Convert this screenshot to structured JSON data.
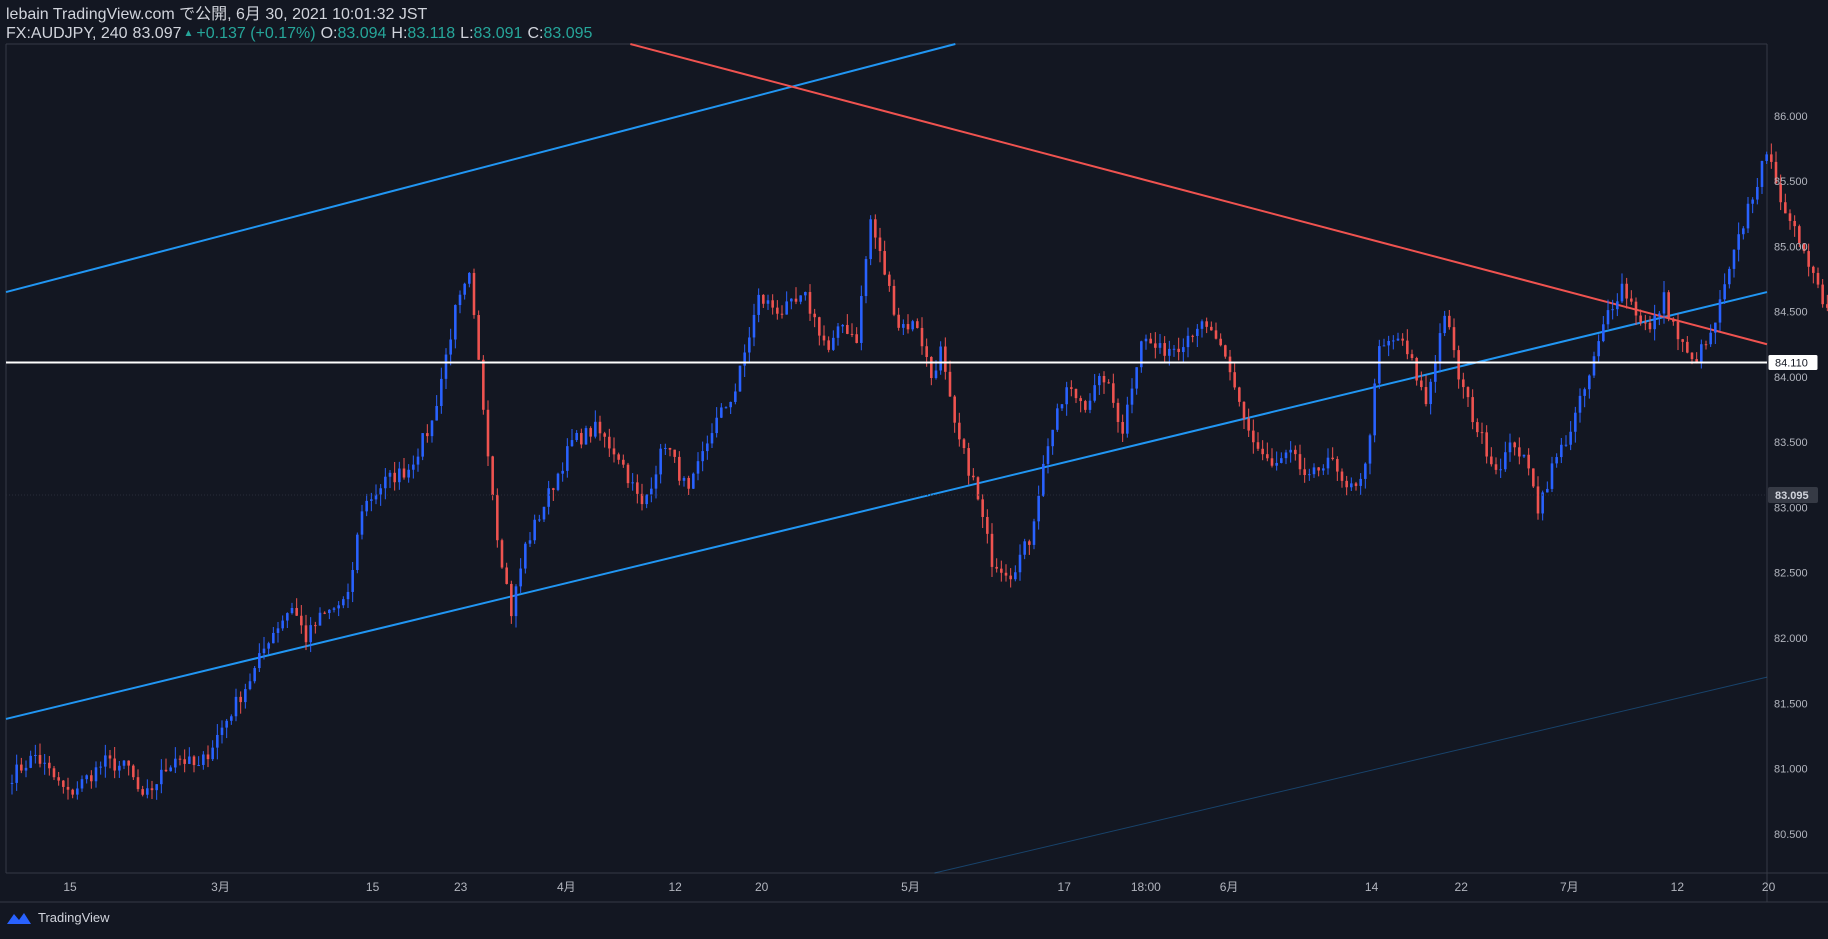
{
  "header": {
    "publish_line": "lebain TradingView.com で公開, 6月 30, 2021 10:01:32 JST",
    "symbol": "FX:AUDJPY, 240",
    "last": "83.097",
    "change": "+0.137 (+0.17%)",
    "o_label": "O:",
    "o_value": "83.094",
    "h_label": "H:",
    "h_value": "83.118",
    "l_label": "L:",
    "l_value": "83.091",
    "c_label": "C:",
    "c_value": "83.095"
  },
  "footer": {
    "brand": "TradingView",
    "icon": "tradingview-logo-icon"
  },
  "colors": {
    "background": "#131722",
    "up": "#2962ff",
    "down": "#ef5350",
    "channel": "#2196f3",
    "resistance": "#f05350",
    "level": "#ffffff",
    "text": "#d1d4dc",
    "ohlc_value": "#26a69a"
  },
  "chart_data": {
    "type": "candlestick",
    "title": "FX:AUDJPY, 240",
    "ylim": [
      80.2,
      86.55
    ],
    "y_ticks": [
      "86.000",
      "85.500",
      "85.000",
      "84.500",
      "84.000",
      "83.500",
      "83.000",
      "82.500",
      "82.000",
      "81.500",
      "81.000",
      "80.500"
    ],
    "x_ticks": [
      "15",
      "3月",
      "15",
      "23",
      "4月",
      "12",
      "20",
      "5月",
      "17",
      "18:00",
      "6月",
      "14",
      "22",
      "7月",
      "12",
      "20"
    ],
    "x_tick_idx": [
      80,
      268,
      458,
      568,
      700,
      836,
      944,
      1130,
      1322,
      1424,
      1528,
      1706,
      1818,
      1953,
      2088,
      2202
    ],
    "price_labels": [
      {
        "label": "84.110",
        "value": 84.11,
        "kind": "level"
      },
      {
        "label": "83.095",
        "value": 83.095,
        "kind": "last"
      }
    ],
    "lines": [
      {
        "name": "channel-upper",
        "color": "channel",
        "from": {
          "idx": 0,
          "price": 84.65
        },
        "to": {
          "idx": 1186,
          "price": 86.55
        }
      },
      {
        "name": "channel-lower",
        "color": "channel",
        "from": {
          "idx": 0,
          "price": 81.38
        },
        "to": {
          "idx": 2200,
          "price": 84.65
        }
      },
      {
        "name": "channel-parallel-faint",
        "color": "channel",
        "faint": true,
        "from": {
          "idx": 1160,
          "price": 80.2
        },
        "to": {
          "idx": 2200,
          "price": 81.7
        }
      },
      {
        "name": "resistance",
        "color": "resistance",
        "from": {
          "idx": 780,
          "price": 86.55
        },
        "to": {
          "idx": 2200,
          "price": 84.25
        }
      }
    ],
    "level_line": {
      "value": 84.11
    },
    "candle_count": 330,
    "idx_per_candle": 5.83,
    "keypoints": [
      [
        0,
        80.95
      ],
      [
        5,
        81.1
      ],
      [
        12,
        80.8
      ],
      [
        20,
        81.05
      ],
      [
        25,
        81.0
      ],
      [
        28,
        80.75
      ],
      [
        35,
        81.1
      ],
      [
        40,
        81.0
      ],
      [
        48,
        81.5
      ],
      [
        52,
        81.75
      ],
      [
        55,
        82.0
      ],
      [
        60,
        82.25
      ],
      [
        63,
        82.0
      ],
      [
        66,
        82.15
      ],
      [
        72,
        82.3
      ],
      [
        75,
        83.0
      ],
      [
        80,
        83.2
      ],
      [
        85,
        83.3
      ],
      [
        90,
        83.65
      ],
      [
        95,
        84.5
      ],
      [
        98,
        84.75
      ],
      [
        100,
        84.1
      ],
      [
        104,
        82.8
      ],
      [
        107,
        82.2
      ],
      [
        110,
        82.7
      ],
      [
        115,
        83.1
      ],
      [
        120,
        83.5
      ],
      [
        125,
        83.6
      ],
      [
        130,
        83.4
      ],
      [
        135,
        83.0
      ],
      [
        140,
        83.5
      ],
      [
        145,
        83.1
      ],
      [
        150,
        83.6
      ],
      [
        155,
        83.9
      ],
      [
        160,
        84.6
      ],
      [
        165,
        84.5
      ],
      [
        170,
        84.6
      ],
      [
        175,
        84.2
      ],
      [
        178,
        84.4
      ],
      [
        181,
        84.3
      ],
      [
        184,
        85.2
      ],
      [
        187,
        84.8
      ],
      [
        190,
        84.4
      ],
      [
        194,
        84.4
      ],
      [
        197,
        84.0
      ],
      [
        199,
        84.2
      ],
      [
        202,
        83.6
      ],
      [
        206,
        83.2
      ],
      [
        210,
        82.6
      ],
      [
        214,
        82.5
      ],
      [
        218,
        82.75
      ],
      [
        222,
        83.5
      ],
      [
        226,
        83.9
      ],
      [
        230,
        83.8
      ],
      [
        234,
        84.0
      ],
      [
        238,
        83.6
      ],
      [
        242,
        84.3
      ],
      [
        246,
        84.2
      ],
      [
        250,
        84.25
      ],
      [
        254,
        84.4
      ],
      [
        258,
        84.3
      ],
      [
        262,
        83.9
      ],
      [
        266,
        83.5
      ],
      [
        270,
        83.3
      ],
      [
        274,
        83.4
      ],
      [
        278,
        83.2
      ],
      [
        282,
        83.4
      ],
      [
        286,
        83.1
      ],
      [
        290,
        83.3
      ],
      [
        293,
        84.2
      ],
      [
        297,
        84.3
      ],
      [
        300,
        84.1
      ],
      [
        303,
        83.8
      ],
      [
        307,
        84.5
      ],
      [
        310,
        84.0
      ],
      [
        314,
        83.6
      ],
      [
        318,
        83.3
      ],
      [
        322,
        83.5
      ],
      [
        326,
        83.2
      ]
    ],
    "keypoints_tail": [
      [
        327,
        83.0
      ],
      [
        330,
        83.3
      ],
      [
        334,
        83.6
      ],
      [
        338,
        84.0
      ],
      [
        342,
        84.5
      ],
      [
        345,
        84.7
      ],
      [
        348,
        84.5
      ],
      [
        351,
        84.35
      ],
      [
        354,
        84.6
      ],
      [
        357,
        84.3
      ],
      [
        360,
        84.1
      ],
      [
        364,
        84.3
      ],
      [
        368,
        84.8
      ],
      [
        372,
        85.3
      ],
      [
        375,
        85.6
      ],
      [
        377,
        85.7
      ],
      [
        380,
        85.2
      ],
      [
        384,
        85.0
      ],
      [
        388,
        84.6
      ],
      [
        392,
        84.4
      ],
      [
        396,
        84.9
      ],
      [
        400,
        84.6
      ],
      [
        404,
        85.0
      ],
      [
        408,
        84.7
      ],
      [
        412,
        84.4
      ],
      [
        416,
        84.5
      ],
      [
        420,
        84.2
      ],
      [
        424,
        84.3
      ],
      [
        428,
        84.1
      ],
      [
        432,
        84.4
      ],
      [
        436,
        84.6
      ],
      [
        440,
        85.0
      ],
      [
        444,
        84.8
      ],
      [
        448,
        84.7
      ],
      [
        452,
        84.9
      ],
      [
        456,
        84.8
      ],
      [
        460,
        84.4
      ],
      [
        464,
        84.6
      ],
      [
        468,
        84.9
      ],
      [
        472,
        84.7
      ],
      [
        476,
        84.8
      ],
      [
        480,
        84.75
      ],
      [
        484,
        84.9
      ],
      [
        488,
        85.0
      ],
      [
        492,
        84.6
      ],
      [
        496,
        84.8
      ],
      [
        500,
        84.7
      ],
      [
        504,
        84.5
      ],
      [
        508,
        84.0
      ],
      [
        512,
        83.4
      ],
      [
        516,
        83.0
      ],
      [
        520,
        82.5
      ],
      [
        524,
        82.3
      ],
      [
        528,
        83.0
      ],
      [
        532,
        82.9
      ],
      [
        536,
        83.5
      ],
      [
        540,
        84.0
      ],
      [
        544,
        84.1
      ],
      [
        548,
        84.05
      ],
      [
        552,
        84.1
      ],
      [
        556,
        84.0
      ],
      [
        560,
        83.6
      ],
      [
        564,
        83.3
      ],
      [
        568,
        83.0
      ],
      [
        570,
        83.09
      ]
    ]
  }
}
